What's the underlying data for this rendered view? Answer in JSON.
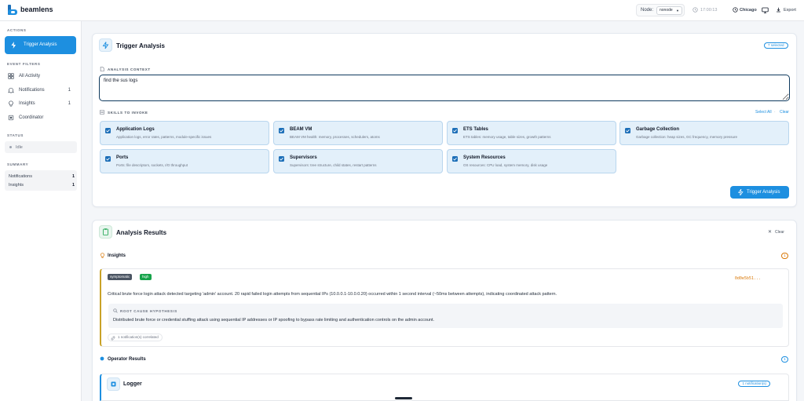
{
  "brand": "beamlens",
  "header": {
    "node_label": "Node:",
    "node_value": "nonode",
    "time": "17:00:13",
    "timezone": "Chicago",
    "export_label": "Export"
  },
  "sidebar": {
    "actions_label": "ACTIONS",
    "trigger_label": "Trigger Analysis",
    "filters_label": "EVENT FILTERS",
    "filters": [
      {
        "label": "All Activity",
        "count": ""
      },
      {
        "label": "Notifications",
        "count": "1"
      },
      {
        "label": "Insights",
        "count": "1"
      },
      {
        "label": "Coordinator",
        "count": ""
      }
    ],
    "status_label": "STATUS",
    "status_value": "Idle",
    "summary_label": "SUMMARY",
    "summary": [
      {
        "label": "Notifications",
        "value": "1"
      },
      {
        "label": "Insights",
        "value": "1"
      }
    ]
  },
  "trigger": {
    "title": "Trigger Analysis",
    "selected_badge": "7 selected",
    "context_label": "ANALYSIS CONTEXT",
    "context_value": "find the sus logs",
    "skills_label": "SKILLS TO INVOKE",
    "select_all": "Select All",
    "separator": "·",
    "clear": "Clear",
    "skills": [
      {
        "name": "Application Logs",
        "desc": "Application logs, error rates, patterns, module-specific issues"
      },
      {
        "name": "BEAM VM",
        "desc": "BEAM VM health: memory, processes, schedulers, atoms"
      },
      {
        "name": "ETS Tables",
        "desc": "ETS tables: memory usage, table sizes, growth patterns"
      },
      {
        "name": "Garbage Collection",
        "desc": "Garbage collection: heap sizes, GC frequency, memory pressure"
      },
      {
        "name": "Ports",
        "desc": "Ports: file descriptors, sockets, I/O throughput"
      },
      {
        "name": "Supervisors",
        "desc": "Supervisors: tree structure, child states, restart patterns"
      },
      {
        "name": "System Resources",
        "desc": "OS resources: CPU load, system memory, disk usage"
      }
    ],
    "button_label": "Trigger Analysis"
  },
  "results": {
    "title": "Analysis Results",
    "clear_label": "Clear",
    "insights_label": "Insights",
    "insights_count": "1",
    "insight": {
      "tags": [
        "symptomatic",
        "high"
      ],
      "hash": "0d0e5b51...",
      "summary": "Critical brute force login attack detected targeting 'admin' account. 20 rapid failed login attempts from sequential IPs (10.0.0.1-10.0.0.20) occurred within 1 second interval (~50ms between attempts), indicating coordinated attack pattern.",
      "root_cause_label": "ROOT CAUSE HYPOTHESIS",
      "root_cause": "Distributed brute force or credential stuffing attack using sequential IP addresses or IP spoofing to bypass rate limiting and authentication controls on the admin account.",
      "correlated": "1 notification(s) correlated"
    },
    "operator_label": "Operator Results",
    "operator_count": "1",
    "logger_title": "Logger",
    "logger_badge": "1 notification(s)"
  },
  "colors": {
    "accent": "#1d8fe0",
    "insight_border": "#c9a227",
    "tag_symptomatic": "#4b5563",
    "tag_high": "#16a34a"
  }
}
